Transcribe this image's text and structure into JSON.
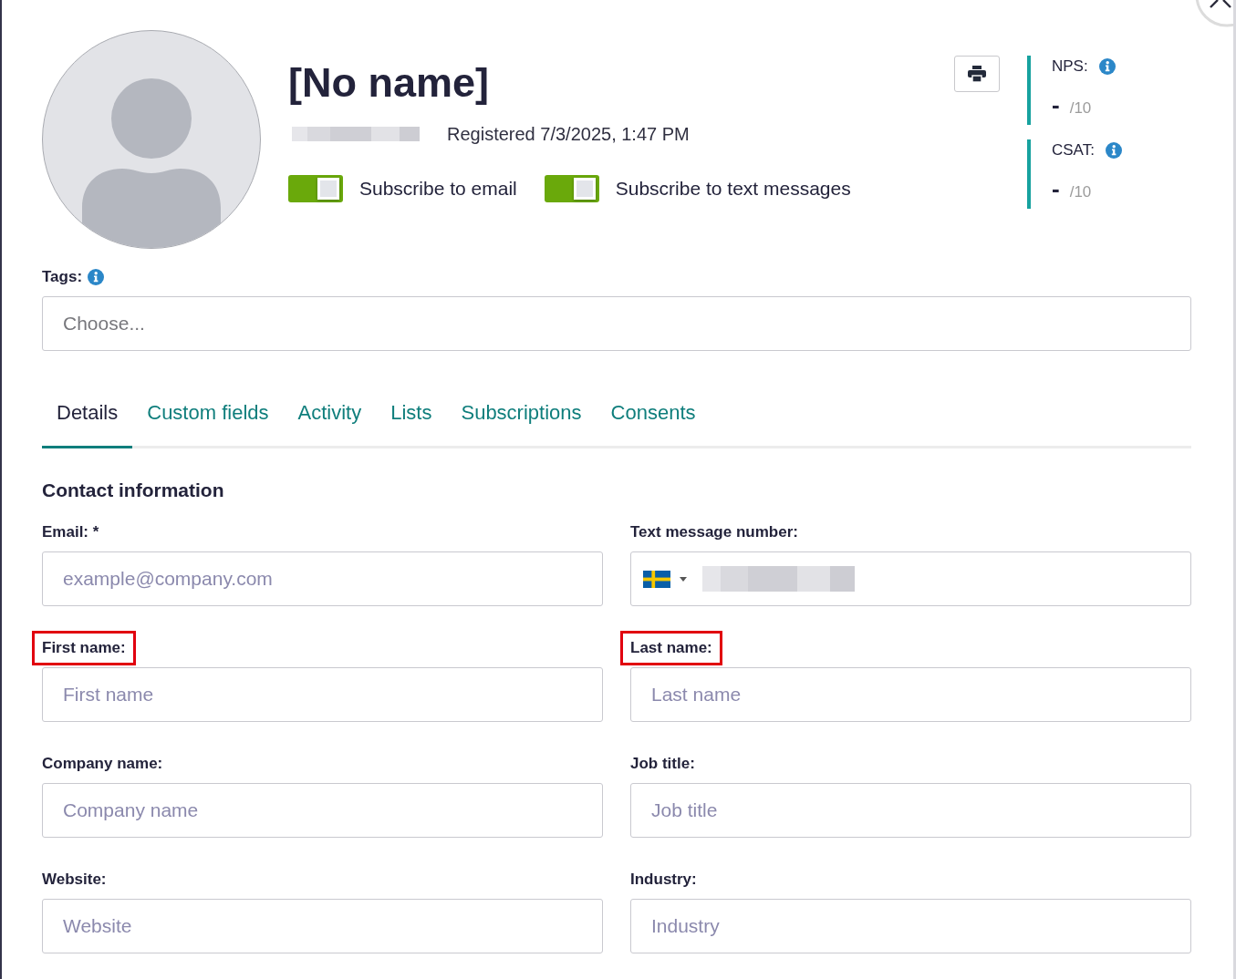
{
  "contact": {
    "name": "[No name]",
    "id_redacted": true,
    "registered": "Registered 7/3/2025, 1:47 PM"
  },
  "subscriptions": [
    {
      "label": "Subscribe to email",
      "on": true
    },
    {
      "label": "Subscribe to text messages",
      "on": true
    }
  ],
  "scores": [
    {
      "label": "NPS:",
      "value": "-",
      "scale": "/10"
    },
    {
      "label": "CSAT:",
      "value": "-",
      "scale": "/10"
    }
  ],
  "tags": {
    "label": "Tags:",
    "placeholder": "Choose..."
  },
  "tabs": [
    {
      "label": "Details",
      "selected": true
    },
    {
      "label": "Custom fields",
      "selected": false
    },
    {
      "label": "Activity",
      "selected": false
    },
    {
      "label": "Lists",
      "selected": false
    },
    {
      "label": "Subscriptions",
      "selected": false
    },
    {
      "label": "Consents",
      "selected": false
    }
  ],
  "section_title": "Contact information",
  "fields": [
    {
      "kind": "text",
      "label": "Email: *",
      "placeholder": "example@company.com",
      "highlighted": false
    },
    {
      "kind": "phone",
      "label": "Text message number:",
      "value_redacted": true,
      "highlighted": false
    },
    {
      "kind": "text",
      "label": "First name:",
      "placeholder": "First name",
      "highlighted": true
    },
    {
      "kind": "text",
      "label": "Last name:",
      "placeholder": "Last name",
      "highlighted": true
    },
    {
      "kind": "text",
      "label": "Company name:",
      "placeholder": "Company name",
      "highlighted": false
    },
    {
      "kind": "text",
      "label": "Job title:",
      "placeholder": "Job title",
      "highlighted": false
    },
    {
      "kind": "text",
      "label": "Website:",
      "placeholder": "Website",
      "highlighted": false
    },
    {
      "kind": "text",
      "label": "Industry:",
      "placeholder": "Industry",
      "highlighted": false
    }
  ]
}
